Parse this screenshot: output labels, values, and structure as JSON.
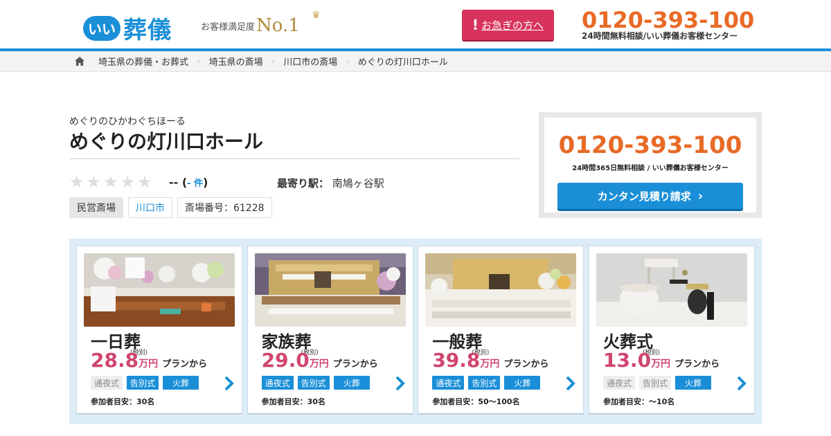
{
  "header": {
    "logo_ii": "いい",
    "logo_text": "葬儀",
    "satisfaction_label": "お客様満足度",
    "satisfaction_rank": "No.1",
    "urgent_button": "お急ぎの方へ",
    "phone": "0120-393-100",
    "phone_sub": "24時間無料相談/いい葬儀お客様センター"
  },
  "breadcrumb": {
    "items": [
      "埼玉県の葬儀・お葬式",
      "埼玉県の斎場",
      "川口市の斎場",
      "めぐりの灯川口ホール"
    ]
  },
  "facility": {
    "kana": "めぐりのひかわぐちほーる",
    "name": "めぐりの灯川口ホール",
    "rating_value": "--",
    "rating_count": "- 件",
    "rating_stars": 0,
    "station_label": "最寄り駅：",
    "station": "南鳩ヶ谷駅",
    "tags": [
      "民営斎場",
      "川口市",
      "斎場番号：61228"
    ]
  },
  "contact": {
    "phone": "0120-393-100",
    "sub": "24時間365日無料相談 / いい葬儀お客様センター",
    "button": "カンタン見積り請求"
  },
  "plans": [
    {
      "name": "一日葬",
      "tax": "(税別)",
      "price": "28.8",
      "unit": "万円",
      "from": "プランから",
      "badges": [
        {
          "label": "通夜式",
          "on": false
        },
        {
          "label": "告別式",
          "on": true
        },
        {
          "label": "火葬",
          "on": true
        }
      ],
      "attendees": "参加者目安：30名"
    },
    {
      "name": "家族葬",
      "tax": "(税別)",
      "price": "29.0",
      "unit": "万円",
      "from": "プランから",
      "badges": [
        {
          "label": "通夜式",
          "on": true
        },
        {
          "label": "告別式",
          "on": true
        },
        {
          "label": "火葬",
          "on": true
        }
      ],
      "attendees": "参加者目安：30名"
    },
    {
      "name": "一般葬",
      "tax": "(税別)",
      "price": "39.8",
      "unit": "万円",
      "from": "プランから",
      "badges": [
        {
          "label": "通夜式",
          "on": true
        },
        {
          "label": "告別式",
          "on": true
        },
        {
          "label": "火葬",
          "on": true
        }
      ],
      "attendees": "参加者目安：50～100名"
    },
    {
      "name": "火葬式",
      "tax": "(税別)",
      "price": "13.0",
      "unit": "万円",
      "from": "プランから",
      "badges": [
        {
          "label": "通夜式",
          "on": false
        },
        {
          "label": "告別式",
          "on": false
        },
        {
          "label": "火葬",
          "on": true
        }
      ],
      "attendees": "参加者目安：～10名"
    }
  ],
  "colors": {
    "brand_blue": "#1a8fd8",
    "phone_orange": "#e86a26",
    "urgent_red": "#d8335c",
    "price_pink": "#d0456e"
  }
}
